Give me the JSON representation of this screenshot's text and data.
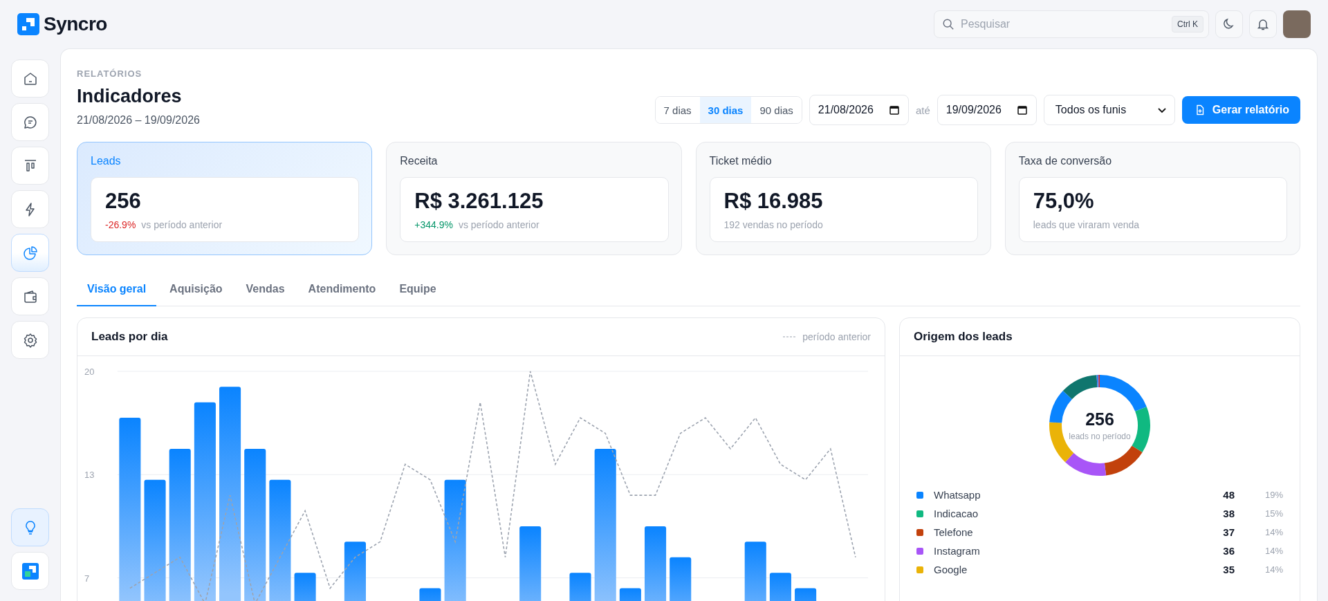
{
  "brand": {
    "name": "Syncro"
  },
  "search": {
    "placeholder": "Pesquisar",
    "shortcut": "Ctrl K"
  },
  "sidebar": {
    "items": [
      {
        "selected": false
      },
      {
        "selected": false
      },
      {
        "selected": false
      },
      {
        "selected": false
      },
      {
        "selected": true
      },
      {
        "selected": false
      },
      {
        "selected": false
      }
    ]
  },
  "header": {
    "eyebrow": "RELATÓRIOS",
    "title": "Indicadores",
    "range": "21/08/2026 – 19/09/2026"
  },
  "periods": [
    {
      "label": "7 dias",
      "selected": false
    },
    {
      "label": "30 dias",
      "selected": true
    },
    {
      "label": "90 dias",
      "selected": false
    }
  ],
  "date_from": {
    "value": "21/08/2026"
  },
  "date_sep": "até",
  "date_to": {
    "value": "19/09/2026"
  },
  "funnel_select": {
    "value": "Todos os funis"
  },
  "generate_button": "Gerar relatório",
  "kpis": [
    {
      "label": "Leads",
      "value": "256",
      "delta": "-26.9%",
      "negative": true,
      "note": "vs período anterior",
      "selected": true
    },
    {
      "label": "Receita",
      "value": "R$ 3.261.125",
      "delta": "+344.9%",
      "negative": false,
      "note": "vs período anterior",
      "selected": false
    },
    {
      "label": "Ticket médio",
      "value": "R$ 16.985",
      "note": "192 vendas no período",
      "selected": false
    },
    {
      "label": "Taxa de conversão",
      "value": "75,0%",
      "note": "leads que viraram venda",
      "selected": false
    }
  ],
  "tabs": [
    {
      "label": "Visão geral",
      "selected": true
    },
    {
      "label": "Aquisição",
      "selected": false
    },
    {
      "label": "Vendas",
      "selected": false
    },
    {
      "label": "Atendimento",
      "selected": false
    },
    {
      "label": "Equipe",
      "selected": false
    }
  ],
  "leads_chart": {
    "title": "Leads por dia",
    "chart_data": {
      "type": "bar",
      "ylim": [
        0,
        20
      ],
      "yticks": [
        {
          "value": 20,
          "label": "20"
        },
        {
          "value": 13.33,
          "label": "13"
        },
        {
          "value": 6.67,
          "label": "7"
        }
      ],
      "series": [
        {
          "color": "#0a84ff",
          "values": [
            17,
            13,
            15,
            18,
            19,
            15,
            13,
            7,
            0,
            9,
            0,
            0,
            6,
            13,
            0,
            0,
            10,
            0,
            7,
            15,
            6,
            10,
            8,
            0,
            0,
            9,
            7,
            6,
            0,
            0
          ]
        },
        {
          "name": "período anterior",
          "type": "line",
          "line_style": "dashed",
          "color": "#9ca3af",
          "values": [
            6,
            7,
            8,
            5,
            12,
            5,
            8,
            11,
            6,
            8,
            9,
            14,
            13,
            9,
            18,
            8,
            20,
            14,
            17,
            16,
            12,
            12,
            16,
            17,
            15,
            17,
            14,
            13,
            15,
            8
          ]
        }
      ]
    }
  },
  "origin_chart": {
    "title": "Origem dos leads",
    "total": "256",
    "total_label": "leads no período",
    "chart_data": {
      "type": "donut",
      "values": [
        19,
        15,
        14,
        14,
        14,
        11,
        12,
        0.6,
        0.4
      ],
      "colors": [
        "#0a84ff",
        "#10b981",
        "#c2410c",
        "#a855f7",
        "#eab308",
        "#0a84ff",
        "#0f766e",
        "#3b82f6",
        "#dc2626"
      ]
    },
    "legend": [
      {
        "name": "Whatsapp",
        "count": "48",
        "share": "19%",
        "color": "#0a84ff"
      },
      {
        "name": "Indicacao",
        "count": "38",
        "share": "15%",
        "color": "#10b981"
      },
      {
        "name": "Telefone",
        "count": "37",
        "share": "14%",
        "color": "#c2410c"
      },
      {
        "name": "Instagram",
        "count": "36",
        "share": "14%",
        "color": "#a855f7"
      },
      {
        "name": "Google",
        "count": "35",
        "share": "14%",
        "color": "#eab308"
      }
    ]
  }
}
